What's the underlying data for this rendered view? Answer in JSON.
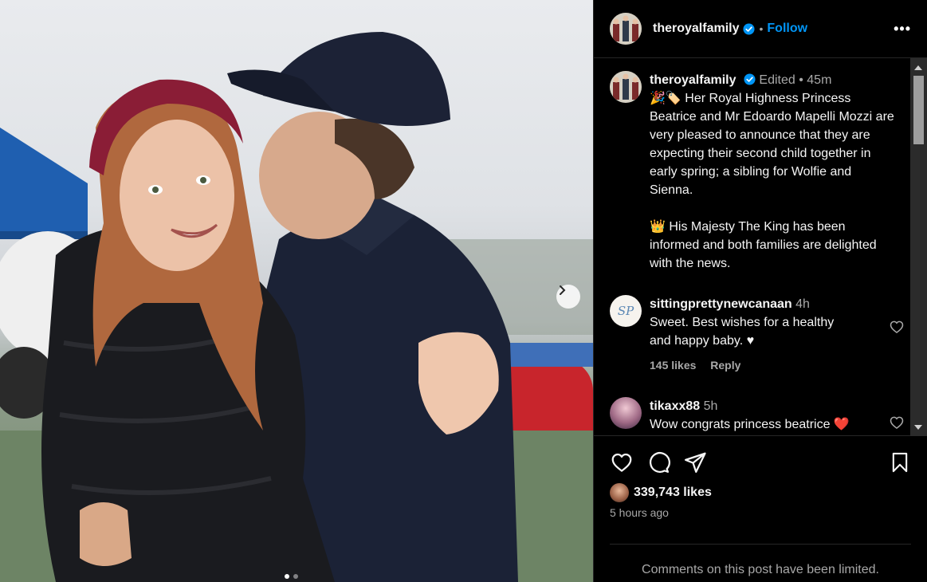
{
  "post": {
    "username": "theroyalfamily",
    "follow_label": "Follow",
    "more_label": "•••",
    "caption": {
      "edited_label": "Edited",
      "time": "45m",
      "emoji_line1": "🎉🏷️",
      "paragraph1": "Her Royal Highness Princess Beatrice and Mr Edoardo Mapelli Mozzi are very pleased to announce that they are expecting their second child together in early spring; a sibling for Wolfie and Sienna.",
      "emoji_line2": "👑",
      "paragraph2": "His Majesty The King has been informed and both families are delighted with the news."
    },
    "comments": [
      {
        "username": "sittingprettynewcanaan",
        "time": "4h",
        "text": "Sweet. Best wishes for a healthy and happy baby. ♥",
        "likes": "145 likes",
        "reply_label": "Reply",
        "avatar_mono": "SP"
      },
      {
        "username": "tikaxx88",
        "time": "5h",
        "text": "Wow congrats princess beatrice ❤️"
      }
    ],
    "likes": "339,743 likes",
    "time_ago": "5 hours ago",
    "comments_limited": "Comments on this post have been limited."
  },
  "carousel": {
    "current_slide": 1,
    "total_slides": 2
  },
  "colors": {
    "accent": "#0095f6",
    "verified": "#0095f6",
    "heart_red": "#ff3040",
    "muted": "#a8a8a8",
    "divider": "#262626"
  },
  "icons": [
    "chevron-right-icon",
    "verified-icon",
    "more-icon",
    "heart-icon",
    "comment-icon",
    "share-icon",
    "bookmark-icon"
  ]
}
